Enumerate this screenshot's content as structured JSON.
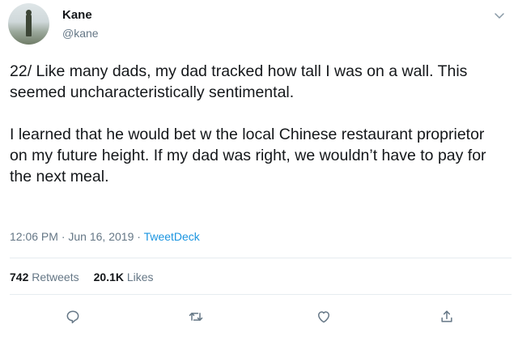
{
  "user": {
    "name": "Kane",
    "handle": "@kane"
  },
  "tweet": {
    "paragraph_1": "22/ Like many dads, my dad tracked how tall I was on a wall. This seemed uncharacteristically sentimental.",
    "paragraph_2": "I learned that he would bet w the local Chinese restaurant proprietor on my future height. If my dad was right, we wouldn’t have to pay for the next meal.",
    "time": "12:06 PM",
    "date": "Jun 16, 2019",
    "separator": "·",
    "source": "TweetDeck"
  },
  "stats": {
    "retweets_count": "742",
    "retweets_label": "Retweets",
    "likes_count": "20.1K",
    "likes_label": "Likes"
  },
  "actions": {
    "icons": [
      "reply-icon",
      "retweet-icon",
      "like-icon",
      "share-icon"
    ]
  },
  "colors": {
    "text": "#14171a",
    "secondary": "#657786",
    "link": "#1b95e0",
    "divider": "#e6ecf0"
  }
}
